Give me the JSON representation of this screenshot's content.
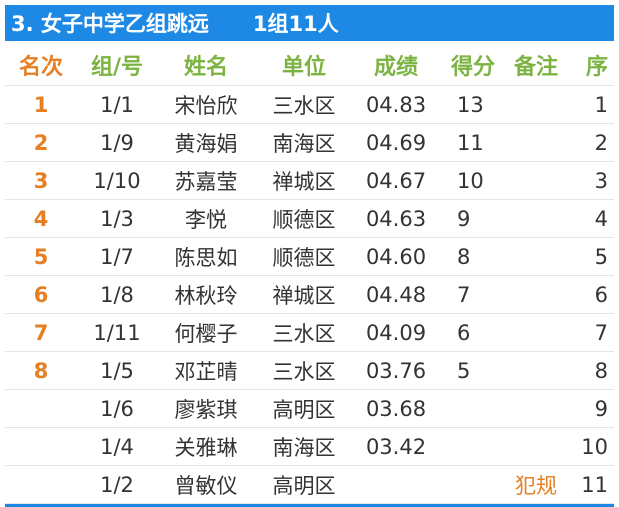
{
  "title": {
    "event": "3. 女子中学乙组跳远",
    "group": "1组11人"
  },
  "headers": {
    "rank": "名次",
    "group_no": "组/号",
    "name": "姓名",
    "unit": "单位",
    "result": "成绩",
    "score": "得分",
    "note": "备注",
    "seq": "序"
  },
  "rows": [
    {
      "rank": "1",
      "group_no": "1/1",
      "name": "宋怡欣",
      "unit": "三水区",
      "result": "04.83",
      "score": "13",
      "note": "",
      "seq": "1"
    },
    {
      "rank": "2",
      "group_no": "1/9",
      "name": "黄海娟",
      "unit": "南海区",
      "result": "04.69",
      "score": "11",
      "note": "",
      "seq": "2"
    },
    {
      "rank": "3",
      "group_no": "1/10",
      "name": "苏嘉莹",
      "unit": "禅城区",
      "result": "04.67",
      "score": "10",
      "note": "",
      "seq": "3"
    },
    {
      "rank": "4",
      "group_no": "1/3",
      "name": "李悦",
      "unit": "顺德区",
      "result": "04.63",
      "score": "9",
      "note": "",
      "seq": "4"
    },
    {
      "rank": "5",
      "group_no": "1/7",
      "name": "陈思如",
      "unit": "顺德区",
      "result": "04.60",
      "score": "8",
      "note": "",
      "seq": "5"
    },
    {
      "rank": "6",
      "group_no": "1/8",
      "name": "林秋玲",
      "unit": "禅城区",
      "result": "04.48",
      "score": "7",
      "note": "",
      "seq": "6"
    },
    {
      "rank": "7",
      "group_no": "1/11",
      "name": "何樱子",
      "unit": "三水区",
      "result": "04.09",
      "score": "6",
      "note": "",
      "seq": "7"
    },
    {
      "rank": "8",
      "group_no": "1/5",
      "name": "邓芷晴",
      "unit": "三水区",
      "result": "03.76",
      "score": "5",
      "note": "",
      "seq": "8"
    },
    {
      "rank": "",
      "group_no": "1/6",
      "name": "廖紫琪",
      "unit": "高明区",
      "result": "03.68",
      "score": "",
      "note": "",
      "seq": "9"
    },
    {
      "rank": "",
      "group_no": "1/4",
      "name": "关雅琳",
      "unit": "南海区",
      "result": "03.42",
      "score": "",
      "note": "",
      "seq": "10"
    },
    {
      "rank": "",
      "group_no": "1/2",
      "name": "曾敏仪",
      "unit": "高明区",
      "result": "",
      "score": "",
      "note": "犯规",
      "seq": "11"
    }
  ],
  "colors": {
    "title_bg": "#1e88e5",
    "header_green": "#7cb342",
    "rank_orange": "#e67e22"
  }
}
